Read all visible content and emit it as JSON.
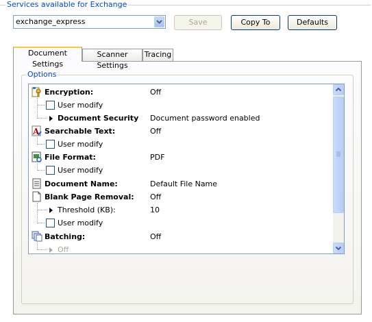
{
  "services_group": {
    "legend": "Services available for Exchange"
  },
  "service_combo": {
    "value": "exchange_express"
  },
  "buttons": {
    "save": "Save",
    "copy_to": "Copy To",
    "defaults": "Defaults"
  },
  "tabs": [
    {
      "label": "Document Settings",
      "active": true
    },
    {
      "label": "Scanner Settings",
      "active": false
    },
    {
      "label": "Tracing",
      "active": false
    }
  ],
  "options": {
    "legend": "Options",
    "rows": [
      {
        "label": "Encryption:",
        "value": "Off"
      },
      {
        "label": "User modify"
      },
      {
        "label": "Document Security",
        "value": "Document password enabled"
      },
      {
        "label": "Searchable Text:",
        "value": "Off"
      },
      {
        "label": "User modify"
      },
      {
        "label": "File Format:",
        "value": "PDF"
      },
      {
        "label": "User modify"
      },
      {
        "label": "Document Name:",
        "value": "Default File Name"
      },
      {
        "label": "Blank Page Removal:",
        "value": "Off"
      },
      {
        "label": "Threshold (KB):",
        "value": "10"
      },
      {
        "label": "User modify"
      },
      {
        "label": "Batching:",
        "value": "Off"
      },
      {
        "label": "Off"
      }
    ]
  },
  "icons": {
    "combo_arrow": "chevron-down-icon",
    "encryption": "lock-key-icon",
    "searchable": "text-a-icon",
    "file_format": "document-image-icon",
    "document_name": "document-lines-icon",
    "blank_page": "blank-page-icon",
    "batching": "batch-pages-icon"
  },
  "colors": {
    "legend_blue": "#0046d5",
    "tab_highlight": "#ffc83c",
    "border": "#7f9db9"
  }
}
